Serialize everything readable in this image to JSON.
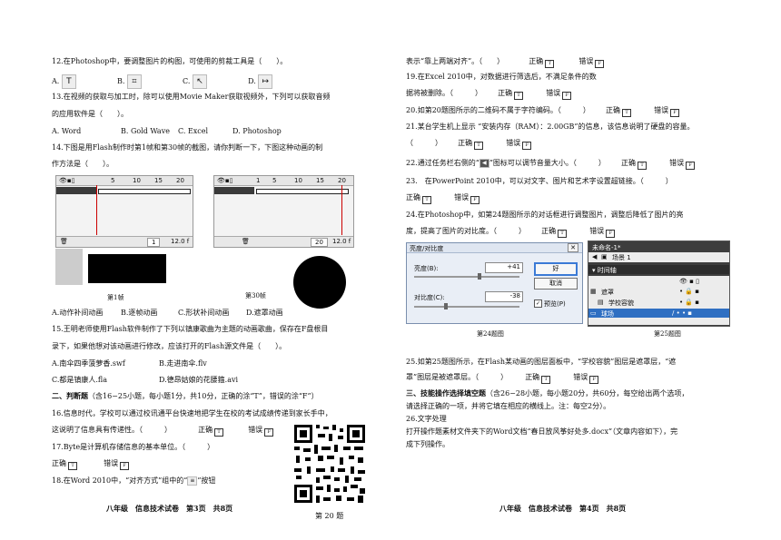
{
  "left": {
    "q12": "12.在Photoshop中，要调整图片的构图，可使用的剪裁工具是（　　）。",
    "q12_opts": {
      "a": "A.",
      "b": "B.",
      "c": "C.",
      "d": "D."
    },
    "q12_icons": {
      "a": "T",
      "b": "⌗",
      "c": "↖",
      "d": "↦"
    },
    "q13_l1": "13.在视频的获取与加工时，除可以使用Movie Maker获取视频外，下列可以获取音频",
    "q13_l2": "的应用软件是（　　）。",
    "q13_opts": [
      "A. Word",
      "B. Gold Wave",
      "C. Excel",
      "D. Photoshop"
    ],
    "q14_l1": "14.下图是用Flash制作时第1帧和第30帧的截图，请你判断一下，下图这种动画的制",
    "q14_l2": "作方法是（　　）。",
    "frame1": {
      "ticks": [
        "5",
        "10",
        "15",
        "20"
      ],
      "frame": "1",
      "fps": "12.0 f",
      "caption": "第1帧"
    },
    "frame30": {
      "ticks": [
        "1",
        "5",
        "10",
        "15",
        "20"
      ],
      "frame": "20",
      "fps": "12.0 f",
      "caption": "第30帧"
    },
    "q14_opts": [
      "A.动作补间动画",
      "B.逐帧动画",
      "C.形状补间动画",
      "D.遮罩动画"
    ],
    "q15_l1": "15.王明老师使用Flash软件制作了下列以镇康歌曲为主题的动画歌曲，保存在F盘根目",
    "q15_l2": "录下，如果他想对该动画进行修改，应该打开的Flash源文件是（　　）。",
    "q15_opts": [
      "A.南伞四季菠萝香.swf",
      "B.走进南伞.flv",
      "C.都是镇康人.fla",
      "D.德昂姑娘的花腰箍.avi"
    ],
    "sec2": "二、判断题",
    "sec2_note": "（含16−25小题，每小题1分，共10分，正确的涂“T”，错误的涂“F”）",
    "q16_l1": "16.信息时代，学校可以通过校讯通平台快速地把学生在校的考试成绩传递到家长手中，",
    "q16_l2": "这说明了信息具有传递性。（　　　）",
    "q17": "17.Byte是计算机存储信息的基本单位。（　　　）",
    "q18": "18.在Word 2010中，“对齐方式”组中的“",
    "q18_tail": "”按钮",
    "right_label": "正确",
    "wrong_label": "错误",
    "box_t": "T",
    "box_f": "F",
    "qr_caption": "第 20 题",
    "footer": "八年级　信息技术试卷　第3页　共8页"
  },
  "right": {
    "q18_cont": "表示“靠上两端对齐”。（　　）",
    "q19_l1": "19.在Excel 2010中，对数据进行筛选后，不满足条件的数",
    "q19_l2": "据将被删除。（　　　）",
    "q20": "20.如第20题图所示的二维码不属于字符编码。（　　　）",
    "q21_l1": "21.某台学生机上显示 “安装内存（RAM）：2.00GB”的信息，该信息说明了硬盘的容量。",
    "q21_l2": "（　　　）",
    "q22": "22.通过任务栏右侧的“",
    "q22_tail": "”图标可以调节音量大小。（　　　）",
    "q23": "23.　在PowerPoint 2010中，可以对文字、图片和艺术字设置超链接。（　　　）",
    "q24_l1": "24.在Photoshop中，如第24题图所示的对话框进行调整图片，调整后降低了图片的亮",
    "q24_l2": "度，提高了图片的对比度。（　　　）",
    "dialog": {
      "title": "亮度/对比度",
      "brightness_label": "亮度(B):",
      "brightness_value": "+41",
      "contrast_label": "对比度(C):",
      "contrast_value": "-38",
      "ok": "好",
      "cancel": "取消",
      "preview": "预览(P)",
      "brightness_level": 0.62,
      "contrast_level": 0.3
    },
    "layers": {
      "title": "未命名-1*",
      "scene": "场景 1",
      "timeline": "▾ 时间轴",
      "items": [
        "遮罩",
        "学校容貌",
        "球场"
      ]
    },
    "cap24": "第24题图",
    "cap25": "第25题图",
    "q25_l1": "25.如第25题图所示，在Flash某动画的图层面板中，“学校容貌”图层是遮罩层，“遮",
    "q25_l2": "罩”图层是被遮罩层。（　　　）",
    "sec3": "三、技能操作选择填空题",
    "sec3_note": "（含26−28小题，每小题20分，共60分，每空给出两个选项，",
    "sec3_l2": "请选择正确的一项，并将它填在相应的横线上。注：每空2分）。",
    "q26": "26.文字处理",
    "q26_l1": "打开操作题素材文件夹下的Word文档“春日放风筝好处多.docx”（文章内容如下），完",
    "q26_l2": "成下列操作。",
    "footer": "八年级　信息技术试卷　第4页　共8页"
  }
}
